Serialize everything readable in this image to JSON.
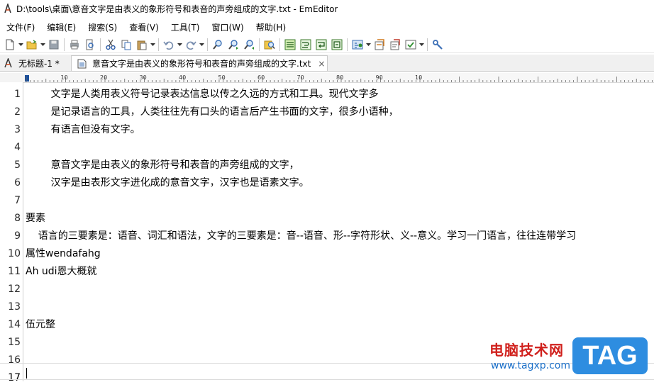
{
  "window": {
    "title": "D:\\tools\\桌面\\意音文字是由表义的象形符号和表音的声旁组成的文字.txt - EmEditor"
  },
  "menu": [
    {
      "label": "文件(F)"
    },
    {
      "label": "编辑(E)"
    },
    {
      "label": "搜索(S)"
    },
    {
      "label": "查看(V)"
    },
    {
      "label": "工具(T)"
    },
    {
      "label": "窗口(W)"
    },
    {
      "label": "帮助(H)"
    }
  ],
  "tabs": [
    {
      "label": "无标题-1 *"
    },
    {
      "label": "意音文字是由表义的象形符号和表音的声旁组成的文字.txt",
      "close": "×"
    }
  ],
  "ruler": {
    "labels": [
      "10",
      "20",
      "30",
      "40",
      "50",
      "60",
      "70",
      "80",
      "90",
      "10"
    ]
  },
  "editor": {
    "lines": [
      {
        "no": "1",
        "text": "        文字是人类用表义符号记录表达信息以传之久远的方式和工具。现代文字多"
      },
      {
        "no": "2",
        "text": "        是记录语言的工具，人类往往先有口头的语言后产生书面的文字，很多小语种，"
      },
      {
        "no": "3",
        "text": "        有语言但没有文字。"
      },
      {
        "no": "4",
        "text": ""
      },
      {
        "no": "5",
        "text": "        意音文字是由表义的象形符号和表音的声旁组成的文字，"
      },
      {
        "no": "6",
        "text": "        汉字是由表形文字进化成的意音文字，汉字也是语素文字。"
      },
      {
        "no": "7",
        "text": ""
      },
      {
        "no": "8",
        "text": "要素"
      },
      {
        "no": "9",
        "text": "    语言的三要素是：语音、词汇和语法，文字的三要素是：音--语音、形--字符形状、义--意义。学习一门语言，往往连带学习"
      },
      {
        "no": "10",
        "text": "属性wendafahg"
      },
      {
        "no": "11",
        "text": "Ah udi恩大概就"
      },
      {
        "no": "12",
        "text": ""
      },
      {
        "no": "13",
        "text": ""
      },
      {
        "no": "14",
        "text": "伍元整"
      },
      {
        "no": "15",
        "text": ""
      },
      {
        "no": "16",
        "text": ""
      },
      {
        "no": "17",
        "text": ""
      }
    ]
  },
  "watermark": {
    "title": "电脑技术网",
    "url": "www.tagxp.com",
    "badge": "TAG"
  }
}
